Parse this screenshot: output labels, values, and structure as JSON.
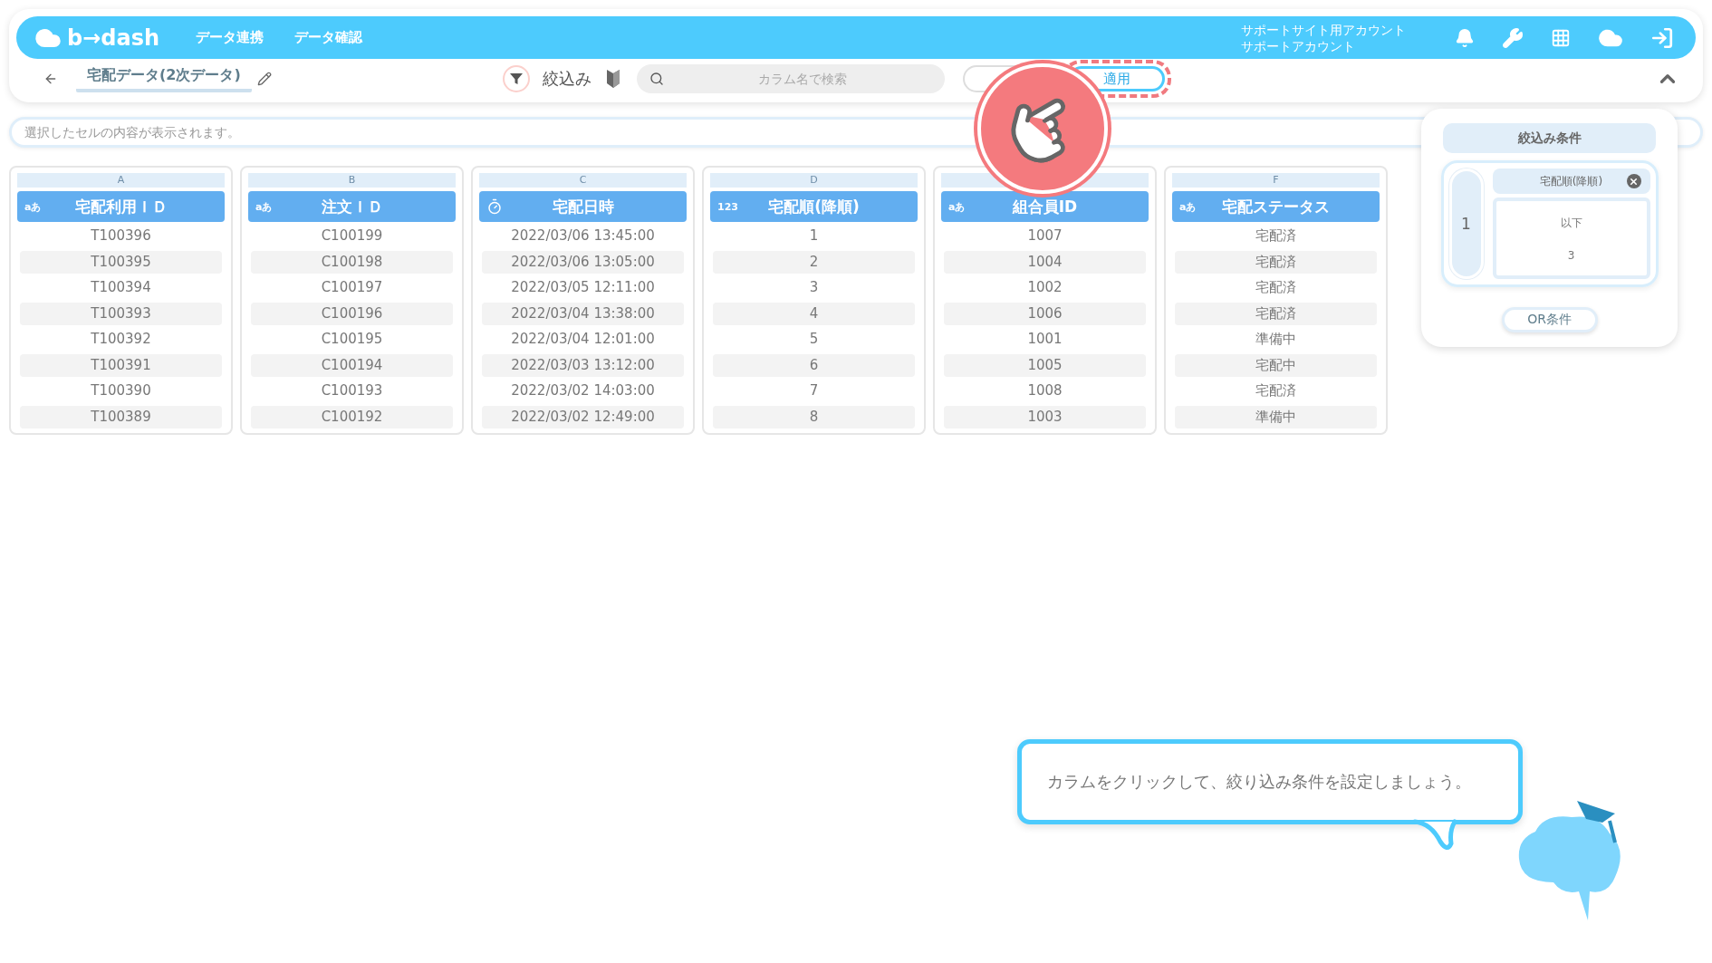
{
  "header": {
    "logo": "b→dash",
    "nav": [
      {
        "label": "データ連携"
      },
      {
        "label": "データ確認"
      }
    ],
    "account": [
      "サポートサイト用アカウント",
      "サポートアカウント"
    ]
  },
  "toolbar": {
    "title": "宅配データ(2次データ)",
    "filter_label": "絞込み",
    "search": {
      "placeholder": "カラム名で検索"
    },
    "apply_button": "適用"
  },
  "cell_content": {
    "placeholder": "選択したセルの内容が表示されます。"
  },
  "table": {
    "columns": [
      {
        "letter": "A",
        "kind": "text",
        "type_label": "aあ",
        "header": "宅配利用ＩＤ",
        "cells": [
          "T100396",
          "T100395",
          "T100394",
          "T100393",
          "T100392",
          "T100391",
          "T100390",
          "T100389"
        ]
      },
      {
        "letter": "B",
        "kind": "text",
        "type_label": "aあ",
        "header": "注文ＩＤ",
        "cells": [
          "C100199",
          "C100198",
          "C100197",
          "C100196",
          "C100195",
          "C100194",
          "C100193",
          "C100192"
        ]
      },
      {
        "letter": "C",
        "kind": "datetime",
        "header": "宅配日時",
        "cells": [
          "2022/03/06 13:45:00",
          "2022/03/06 13:05:00",
          "2022/03/05 12:11:00",
          "2022/03/04 13:38:00",
          "2022/03/04 12:01:00",
          "2022/03/03 13:12:00",
          "2022/03/02 14:03:00",
          "2022/03/02 12:49:00"
        ]
      },
      {
        "letter": "D",
        "kind": "number",
        "type_label": "123",
        "header": "宅配順(降順)",
        "cells": [
          "1",
          "2",
          "3",
          "4",
          "5",
          "6",
          "7",
          "8"
        ]
      },
      {
        "kind": "text",
        "type_label": "aあ",
        "header": "組合員ID",
        "cells": [
          "1007",
          "1004",
          "1002",
          "1006",
          "1001",
          "1005",
          "1008",
          "1003"
        ]
      },
      {
        "letter": "F",
        "kind": "text",
        "type_label": "aあ",
        "header": "宅配ステータス",
        "cells": [
          "宅配済",
          "宅配済",
          "宅配済",
          "宅配済",
          "準備中",
          "宅配中",
          "宅配済",
          "準備中"
        ]
      }
    ]
  },
  "filter_panel": {
    "title": "絞込み条件",
    "conditions": [
      {
        "index": "1",
        "column": "宅配順(降順)",
        "operator": "以下",
        "value": "3"
      }
    ],
    "or_button": "OR条件"
  },
  "tip": {
    "text": "カラムをクリックして、絞り込み条件を設定しましょう。"
  }
}
